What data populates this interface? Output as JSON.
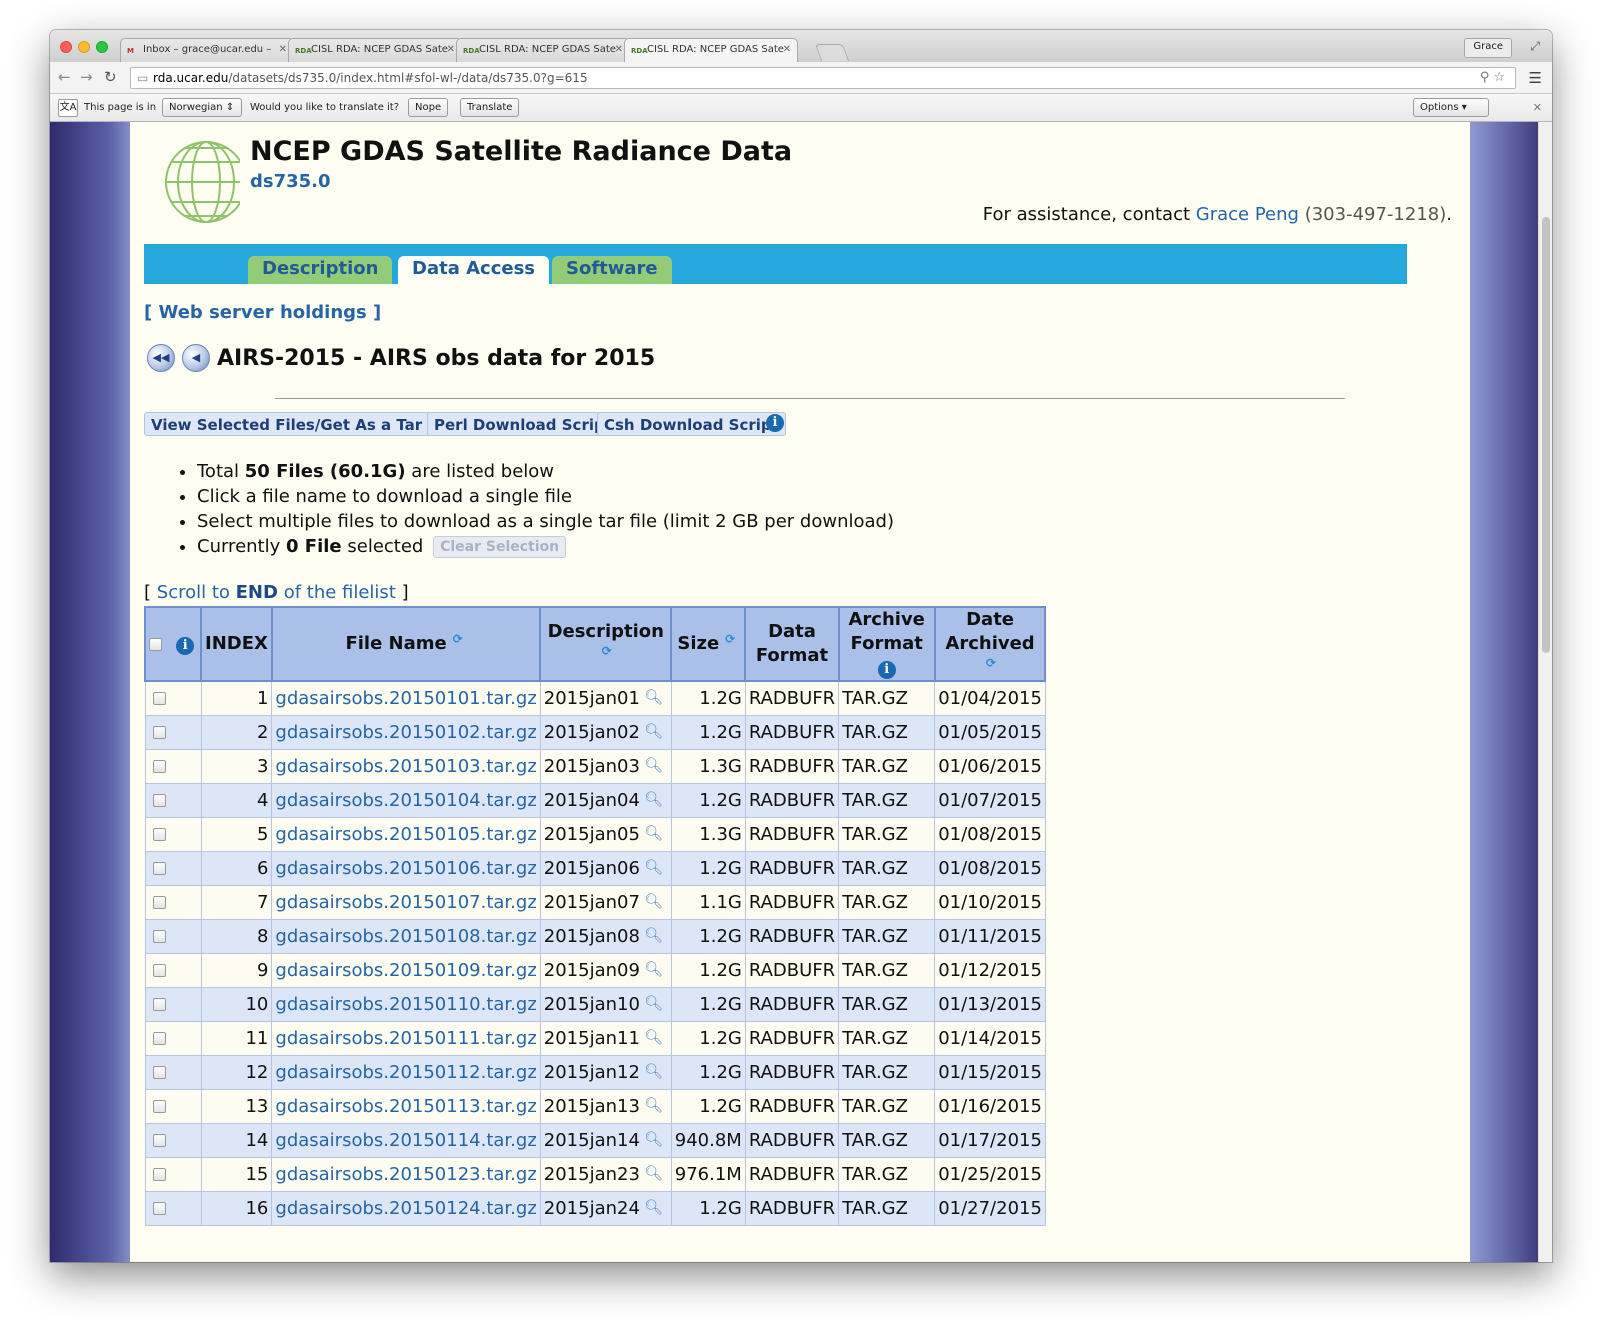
{
  "browser": {
    "tabs": [
      {
        "favicon": "M",
        "title": "Inbox – grace@ucar.edu –"
      },
      {
        "favicon": "RDA",
        "title": "CISL RDA: NCEP GDAS Sate"
      },
      {
        "favicon": "RDA",
        "title": "CISL RDA: NCEP GDAS Sate"
      },
      {
        "favicon": "RDA",
        "title": "CISL RDA: NCEP GDAS Sate"
      }
    ],
    "user": "Grace",
    "url_host": "rda.ucar.edu",
    "url_path": "/datasets/ds735.0/index.html#sfol-wl-/data/ds735.0?g=615",
    "translate": {
      "prefix": "This page is in",
      "language": "Norwegian",
      "question": "Would you like to translate it?",
      "nope": "Nope",
      "translate": "Translate",
      "options": "Options"
    }
  },
  "header": {
    "title": "NCEP GDAS Satellite Radiance Data",
    "dataset_id": "ds735.0",
    "assist_prefix": "For assistance, contact",
    "contact_name": "Grace Peng",
    "contact_phone": "(303-497-1218)",
    "assist_suffix": "."
  },
  "tabs": {
    "description": "Description",
    "data_access": "Data Access",
    "software": "Software"
  },
  "holdings_link": "[ Web server holdings ]",
  "section_title": "AIRS-2015 - AIRS obs data for 2015",
  "actions": {
    "view_tar": "View Selected Files/Get As a Tar File",
    "perl": "Perl Download Script",
    "csh": "Csh Download Script"
  },
  "summary": {
    "total_prefix": "Total",
    "total_bold": "50 Files (60.1G)",
    "total_suffix": "are listed below",
    "line2": "Click a file name to download a single file",
    "line3": "Select multiple files to download as a single tar file (limit 2 GB per download)",
    "current_prefix": "Currently",
    "current_bold": "0 File",
    "current_suffix": "selected",
    "clear": "Clear Selection"
  },
  "scroll_end": {
    "open": "[",
    "pre": "Scroll to",
    "bold": "END",
    "post": "of the filelist",
    "close": "]"
  },
  "table": {
    "headers": {
      "index": "INDEX",
      "file_name": "File Name",
      "description": "Description",
      "size": "Size",
      "data_format_1": "Data",
      "data_format_2": "Format",
      "archive_format_1": "Archive",
      "archive_format_2": "Format",
      "date_1": "Date",
      "date_2": "Archived"
    },
    "rows": [
      [
        "1",
        "gdasairsobs.20150101.tar.gz",
        "2015jan01",
        "1.2G",
        "RADBUFR",
        "TAR.GZ",
        "01/04/2015"
      ],
      [
        "2",
        "gdasairsobs.20150102.tar.gz",
        "2015jan02",
        "1.2G",
        "RADBUFR",
        "TAR.GZ",
        "01/05/2015"
      ],
      [
        "3",
        "gdasairsobs.20150103.tar.gz",
        "2015jan03",
        "1.3G",
        "RADBUFR",
        "TAR.GZ",
        "01/06/2015"
      ],
      [
        "4",
        "gdasairsobs.20150104.tar.gz",
        "2015jan04",
        "1.2G",
        "RADBUFR",
        "TAR.GZ",
        "01/07/2015"
      ],
      [
        "5",
        "gdasairsobs.20150105.tar.gz",
        "2015jan05",
        "1.3G",
        "RADBUFR",
        "TAR.GZ",
        "01/08/2015"
      ],
      [
        "6",
        "gdasairsobs.20150106.tar.gz",
        "2015jan06",
        "1.2G",
        "RADBUFR",
        "TAR.GZ",
        "01/08/2015"
      ],
      [
        "7",
        "gdasairsobs.20150107.tar.gz",
        "2015jan07",
        "1.1G",
        "RADBUFR",
        "TAR.GZ",
        "01/10/2015"
      ],
      [
        "8",
        "gdasairsobs.20150108.tar.gz",
        "2015jan08",
        "1.2G",
        "RADBUFR",
        "TAR.GZ",
        "01/11/2015"
      ],
      [
        "9",
        "gdasairsobs.20150109.tar.gz",
        "2015jan09",
        "1.2G",
        "RADBUFR",
        "TAR.GZ",
        "01/12/2015"
      ],
      [
        "10",
        "gdasairsobs.20150110.tar.gz",
        "2015jan10",
        "1.2G",
        "RADBUFR",
        "TAR.GZ",
        "01/13/2015"
      ],
      [
        "11",
        "gdasairsobs.20150111.tar.gz",
        "2015jan11",
        "1.2G",
        "RADBUFR",
        "TAR.GZ",
        "01/14/2015"
      ],
      [
        "12",
        "gdasairsobs.20150112.tar.gz",
        "2015jan12",
        "1.2G",
        "RADBUFR",
        "TAR.GZ",
        "01/15/2015"
      ],
      [
        "13",
        "gdasairsobs.20150113.tar.gz",
        "2015jan13",
        "1.2G",
        "RADBUFR",
        "TAR.GZ",
        "01/16/2015"
      ],
      [
        "14",
        "gdasairsobs.20150114.tar.gz",
        "2015jan14",
        "940.8M",
        "RADBUFR",
        "TAR.GZ",
        "01/17/2015"
      ],
      [
        "15",
        "gdasairsobs.20150123.tar.gz",
        "2015jan23",
        "976.1M",
        "RADBUFR",
        "TAR.GZ",
        "01/25/2015"
      ],
      [
        "16",
        "gdasairsobs.20150124.tar.gz",
        "2015jan24",
        "1.2G",
        "RADBUFR",
        "TAR.GZ",
        "01/27/2015"
      ]
    ]
  },
  "icons": {
    "info": "info-icon",
    "sort": "refresh-sort-icon",
    "preview": "magnifier-icon",
    "first": "first-page-icon",
    "prev": "previous-page-icon"
  },
  "colors": {
    "nav_bar": "#27a8dd",
    "tab_inactive": "#92cc78",
    "link": "#2565a6",
    "table_header": "#aac0e8"
  }
}
